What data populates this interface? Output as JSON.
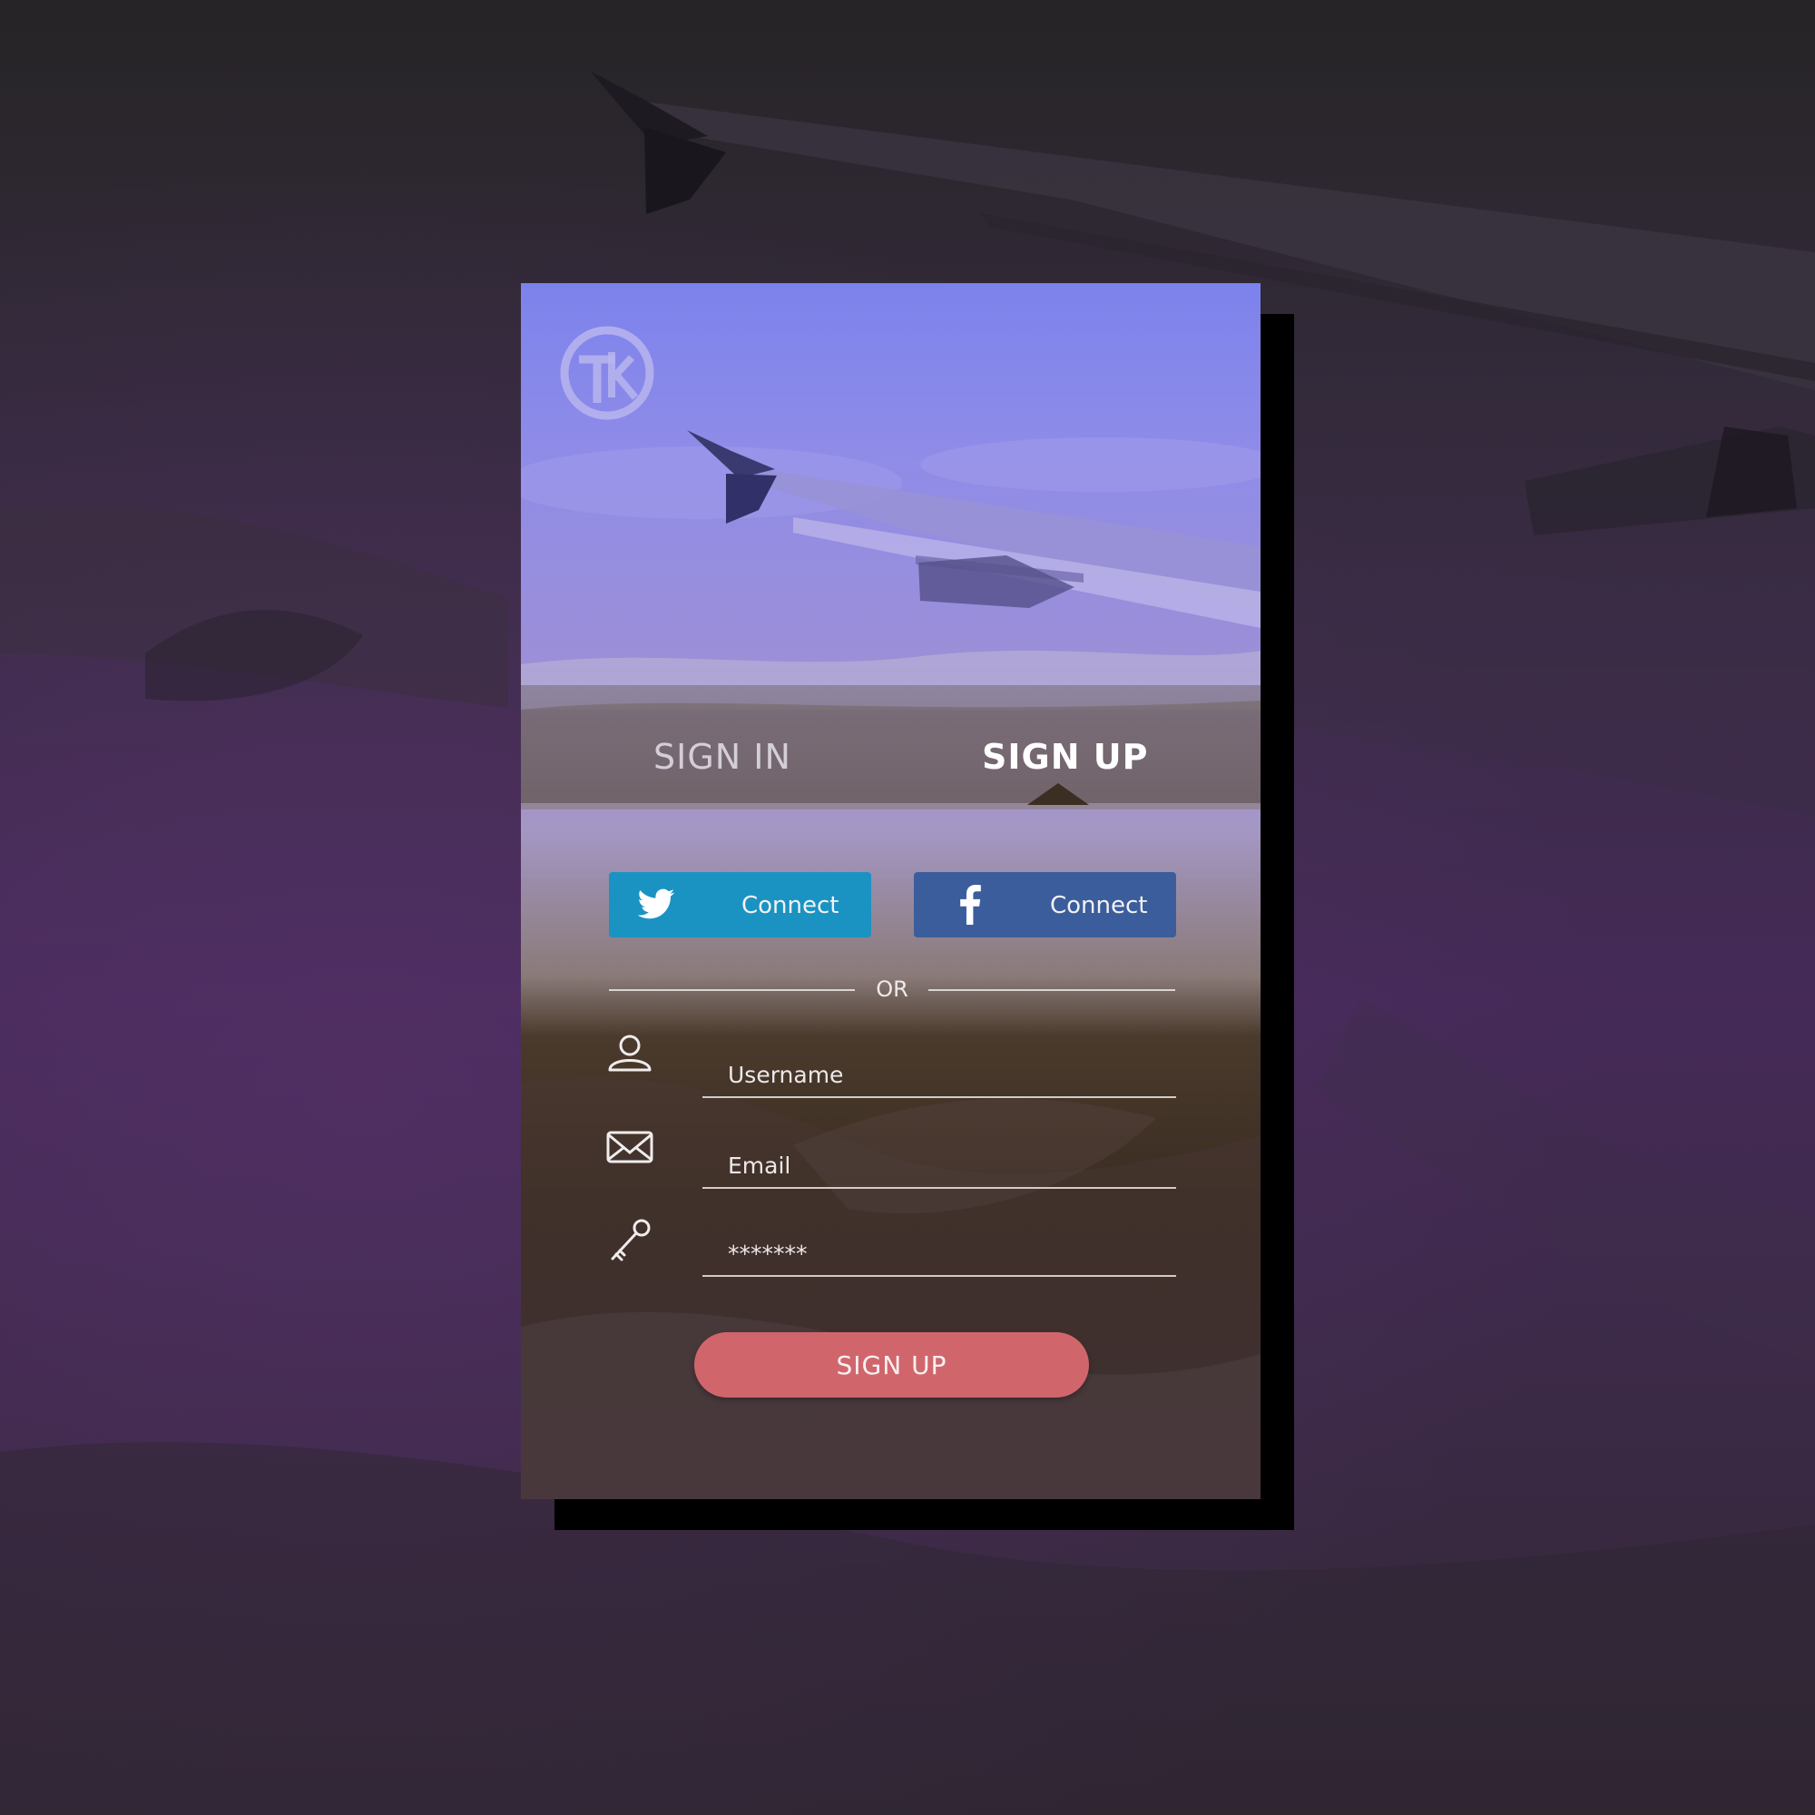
{
  "tabs": {
    "sign_in": "SIGN IN",
    "sign_up": "SIGN UP",
    "active": "sign_up"
  },
  "social": {
    "twitter": {
      "label": "Connect",
      "icon": "twitter-icon",
      "color": "#1a93c3"
    },
    "facebook": {
      "label": "Connect",
      "icon": "facebook-icon",
      "color": "#3b5d9c"
    }
  },
  "divider": {
    "text": "OR"
  },
  "form": {
    "username": {
      "placeholder": "Username",
      "value": "",
      "icon": "user-icon"
    },
    "email": {
      "placeholder": "Email",
      "value": "",
      "icon": "envelope-icon"
    },
    "password": {
      "placeholder": "*******",
      "value": "",
      "icon": "key-icon"
    }
  },
  "submit": {
    "label": "SIGN UP",
    "color": "#d0666c"
  },
  "colors": {
    "card_top": "#7c82ec",
    "card_bottom": "#3b2a32",
    "background": "#452a58"
  }
}
